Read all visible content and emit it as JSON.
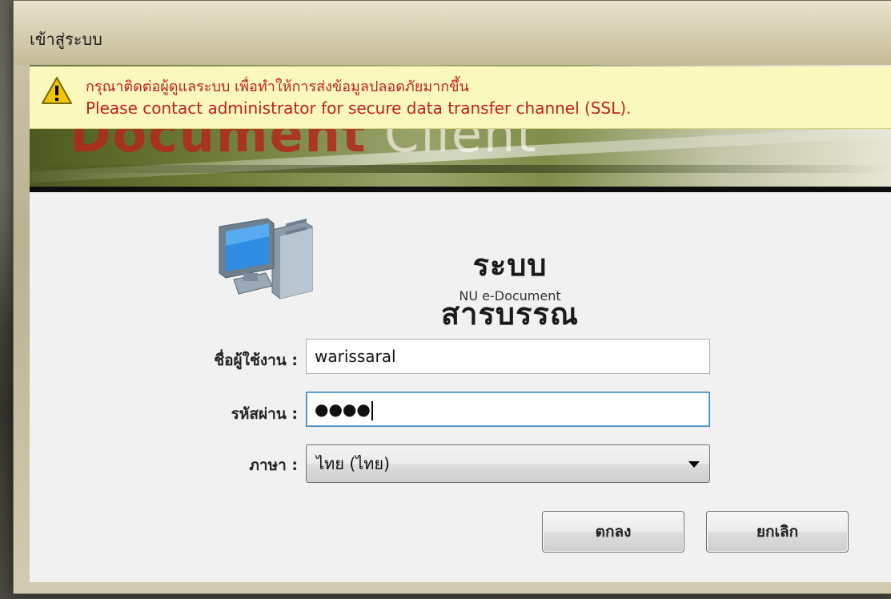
{
  "window": {
    "title": "เข้าสู่ระบบ"
  },
  "warning": {
    "icon": "warning-icon",
    "line_th": "กรุณาติดต่อผู้ดูแลระบบ เพื่อทำให้การส่งข้อมูลปลอดภัยมากขึ้น",
    "line_en": "Please contact administrator for secure data transfer channel (SSL)."
  },
  "banner": {
    "text_document": "Document",
    "text_client": " Client"
  },
  "app": {
    "icon": "computer-icon",
    "title": "ระบบสารบรรณ",
    "subtitle": "NU e-Document"
  },
  "form": {
    "username_label": "ชื่อผู้ใช้งาน :",
    "username_value": "warissaral",
    "password_label": "รหัสผ่าน :",
    "password_display": "●●●●",
    "language_label": "ภาษา :",
    "language_value": "ไทย (ไทย)"
  },
  "buttons": {
    "ok_label": "ตกลง",
    "cancel_label": "ยกเลิก"
  },
  "colors": {
    "warning_bg": "#fbf8bd",
    "warning_text": "#c01f1f",
    "banner_red": "#b2271d"
  }
}
